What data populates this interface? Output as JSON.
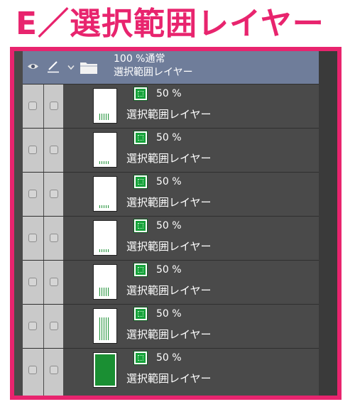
{
  "heading": "E／選択範囲レイヤー",
  "colors": {
    "accent": "#e8246e",
    "panel_bg": "#4a4a4a",
    "folder_row_bg": "#6f7d9a",
    "mask_green": "#16a23a",
    "thumb_green": "#1a8f33"
  },
  "header": {
    "eye_icon": "eye-icon",
    "pen_icon": "pen-icon"
  },
  "folder": {
    "expand_icon": "chevron-down-icon",
    "folder_icon": "folder-icon",
    "line1": "100 %通常",
    "line2": "選択範囲レイヤー"
  },
  "layers": [
    {
      "opacity": "50 %",
      "name": "選択範囲レイヤー",
      "thumb_fill": 0.2
    },
    {
      "opacity": "50 %",
      "name": "選択範囲レイヤー",
      "thumb_fill": 0.02
    },
    {
      "opacity": "50 %",
      "name": "選択範囲レイヤー",
      "thumb_fill": 0.05
    },
    {
      "opacity": "50 %",
      "name": "選択範囲レイヤー",
      "thumb_fill": 0.08
    },
    {
      "opacity": "50 %",
      "name": "選択範囲レイヤー",
      "thumb_fill": 0.25
    },
    {
      "opacity": "50 %",
      "name": "選択範囲レイヤー",
      "thumb_fill": 0.7
    },
    {
      "opacity": "50 %",
      "name": "選択範囲レイヤー",
      "thumb_fill": 1.0
    }
  ]
}
